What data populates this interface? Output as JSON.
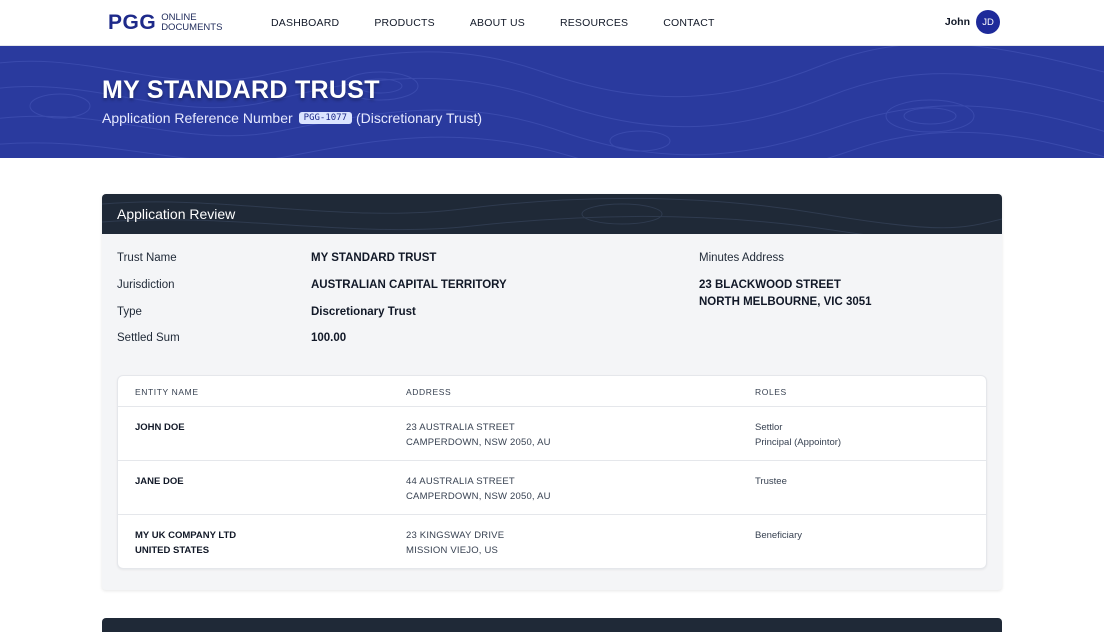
{
  "nav": {
    "logo": "PGG",
    "logo_sub_1": "ONLINE",
    "logo_sub_2": "DOCUMENTS",
    "links": [
      "DASHBOARD",
      "PRODUCTS",
      "ABOUT US",
      "RESOURCES",
      "CONTACT"
    ],
    "user_name": "John",
    "avatar_initials": "JD"
  },
  "hero": {
    "title": "MY STANDARD TRUST",
    "sub_prefix": "Application Reference Number",
    "reference": "PGG-1077",
    "sub_suffix": "(Discretionary Trust)"
  },
  "review": {
    "title": "Application Review",
    "fields": [
      {
        "label": "Trust Name",
        "value": "MY STANDARD TRUST"
      },
      {
        "label": "Jurisdiction",
        "value": "AUSTRALIAN CAPITAL TERRITORY"
      },
      {
        "label": "Type",
        "value": "Discretionary Trust"
      },
      {
        "label": "Settled Sum",
        "value": "100.00"
      }
    ],
    "minutes_label": "Minutes Address",
    "minutes_line1": "23 BLACKWOOD STREET",
    "minutes_line2": "NORTH MELBOURNE, VIC 3051"
  },
  "entities": {
    "headers": [
      "ENTITY NAME",
      "ADDRESS",
      "ROLES"
    ],
    "rows": [
      {
        "name": [
          "JOHN DOE",
          ""
        ],
        "address": [
          "23 AUSTRALIA STREET",
          "CAMPERDOWN, NSW 2050, AU"
        ],
        "roles": [
          "Settlor",
          "Principal (Appointor)"
        ]
      },
      {
        "name": [
          "JANE DOE",
          ""
        ],
        "address": [
          "44 AUSTRALIA STREET",
          "CAMPERDOWN, NSW 2050, AU"
        ],
        "roles": [
          "Trustee",
          ""
        ]
      },
      {
        "name": [
          "MY UK COMPANY LTD",
          "UNITED STATES"
        ],
        "address": [
          "23 KINGSWAY DRIVE",
          "MISSION VIEJO, US"
        ],
        "roles": [
          "Beneficiary",
          ""
        ]
      }
    ]
  },
  "colors": {
    "brand": "#1e2a8a",
    "hero_bg": "#2a3a9e",
    "card_header": "#1f2937",
    "card_bg": "#f4f5f7"
  }
}
